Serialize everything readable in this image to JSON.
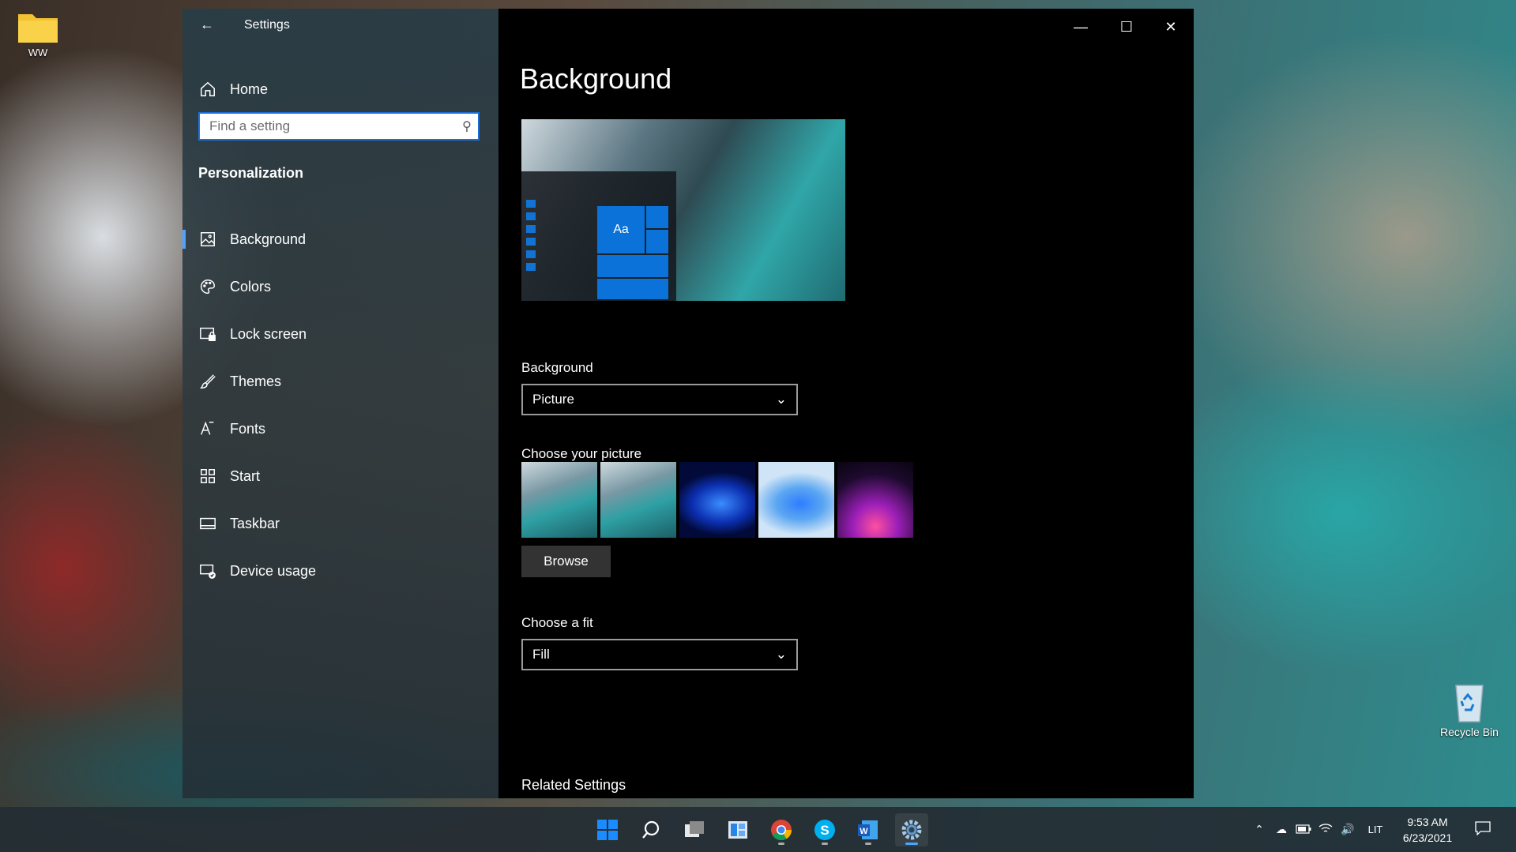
{
  "desktop": {
    "folder_label": "WW",
    "recycle_label": "Recycle Bin"
  },
  "window": {
    "title": "Settings",
    "home_label": "Home",
    "search_placeholder": "Find a setting",
    "section_heading": "Personalization",
    "nav_items": [
      {
        "label": "Background",
        "icon": "picture-icon",
        "active": true
      },
      {
        "label": "Colors",
        "icon": "palette-icon"
      },
      {
        "label": "Lock screen",
        "icon": "lock-screen-icon"
      },
      {
        "label": "Themes",
        "icon": "brush-icon"
      },
      {
        "label": "Fonts",
        "icon": "font-icon"
      },
      {
        "label": "Start",
        "icon": "start-icon"
      },
      {
        "label": "Taskbar",
        "icon": "taskbar-icon"
      },
      {
        "label": "Device usage",
        "icon": "device-usage-icon"
      }
    ]
  },
  "content": {
    "page_title": "Background",
    "preview_tile_text": "Aa",
    "background_label": "Background",
    "background_value": "Picture",
    "choose_picture_label": "Choose your picture",
    "browse_label": "Browse",
    "fit_label": "Choose a fit",
    "fit_value": "Fill",
    "related_label": "Related Settings"
  },
  "taskbar": {
    "apps": [
      "windows-start-icon",
      "search-icon",
      "task-view-icon",
      "widgets-icon",
      "chrome-icon",
      "skype-icon",
      "word-icon",
      "settings-icon"
    ],
    "language": "LIT",
    "time": "9:53 AM",
    "date": "6/23/2021"
  },
  "colors": {
    "accent": "#0078d7",
    "search_border": "#1d6fd8"
  }
}
